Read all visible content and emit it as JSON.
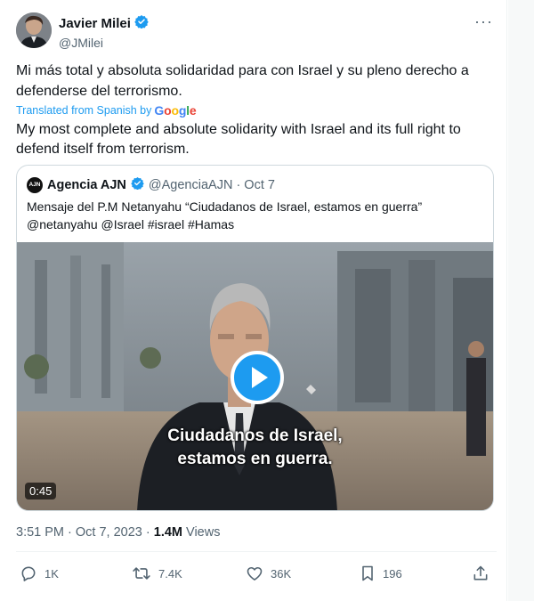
{
  "author": {
    "name": "Javier Milei",
    "handle": "@JMilei",
    "verified_color": "#1d9bf0"
  },
  "more_icon": "more-horizontal-icon",
  "tweet": {
    "text": "Mi más total y absoluta solidaridad para con Israel y su pleno derecho a defenderse del terrorismo.",
    "translated_label": "Translated from Spanish by",
    "translated_brand": "Google",
    "translation": "My most complete and absolute solidarity with Israel and its full right to defend itself from terrorism."
  },
  "quote": {
    "avatar_text": "AJN",
    "name": "Agencia AJN",
    "meta": "@AgenciaAJN · Oct 7",
    "text_line1": "Mensaje del P.M Netanyahu “Ciudadanos de Israel, estamos en guerra”",
    "text_line2": "@netanyahu @Israel #israel #Hamas",
    "video": {
      "subtitle_line1": "Ciudadanos de Israel,",
      "subtitle_line2": "estamos en guerra.",
      "duration": "0:45"
    }
  },
  "timestamp": {
    "time": "3:51 PM · Oct 7, 2023 · ",
    "views_count": "1.4M",
    "views_label": " Views"
  },
  "actions": {
    "replies": "1K",
    "reposts": "7.4K",
    "likes": "36K",
    "bookmarks": "196"
  },
  "colors": {
    "accent": "#1d9bf0",
    "text": "#0f1419",
    "secondary": "#536471"
  }
}
